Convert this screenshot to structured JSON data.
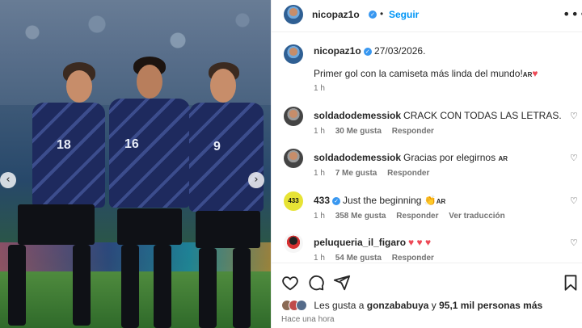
{
  "post": {
    "username": "nicopaz1o",
    "follow_label": "Seguir",
    "more_icon": "more-horizontal-icon",
    "separator": "•"
  },
  "photo": {
    "jersey_numbers": [
      "18",
      "16",
      "9"
    ],
    "nav_prev": "‹",
    "nav_next": "›"
  },
  "caption": {
    "username": "nicopaz1o",
    "date": "27/03/2026.",
    "text": "Primer gol con la camiseta más linda del mundo!",
    "flag": "AR",
    "heart": "♥",
    "time": "1 h"
  },
  "comments": [
    {
      "username": "soldadodemessiok",
      "text": "CRACK CON TODAS LAS LETRAS.",
      "time": "1 h",
      "likes": "30 Me gusta",
      "reply": "Responder",
      "avatar": "bw"
    },
    {
      "username": "soldadodemessiok",
      "text": "Gracias por elegirnos",
      "flag": "AR",
      "time": "1 h",
      "likes": "7 Me gusta",
      "reply": "Responder",
      "avatar": "bw"
    },
    {
      "username": "433",
      "verified": true,
      "text": "Just the beginning",
      "emoji": "👏",
      "flag": "AR",
      "time": "1 h",
      "likes": "358 Me gusta",
      "reply": "Responder",
      "translate": "Ver traducción",
      "avatar_text": "433"
    },
    {
      "username": "peluqueria_il_figaro",
      "text": "♥ ♥ ♥",
      "time": "1 h",
      "likes": "54 Me gusta",
      "reply": "Responder",
      "avatar": "peluq"
    }
  ],
  "actions": {
    "like_icon": "heart-icon",
    "comment_icon": "comment-icon",
    "share_icon": "send-icon",
    "save_icon": "bookmark-icon",
    "likes_prefix": "Les gusta a",
    "likes_user": "gonzababuya",
    "likes_middle": "y",
    "likes_others": "95,1 mil personas más",
    "post_time": "Hace una hora"
  },
  "colors": {
    "accent_blue": "#0095f6",
    "verified_blue": "#3897f0",
    "heart_red": "#ed4956",
    "meta_gray": "#737373"
  }
}
